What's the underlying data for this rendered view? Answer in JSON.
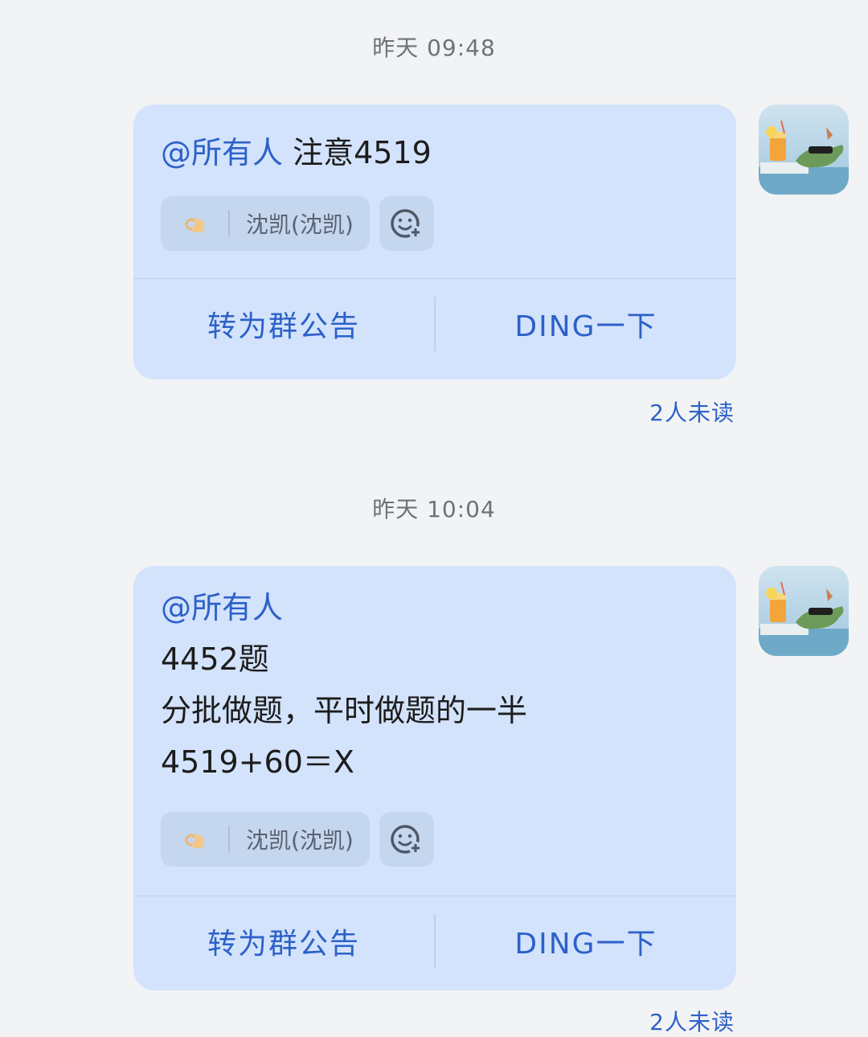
{
  "messages": [
    {
      "timestamp": "昨天 09:48",
      "mention": "@所有人",
      "text_lines": [
        "注意4519"
      ],
      "reaction": {
        "emoji": "ok-hand-icon",
        "users": "沈凯(沈凯)"
      },
      "actions": [
        "转为群公告",
        "DING一下"
      ],
      "read_status": "2人未读"
    },
    {
      "timestamp": "昨天 10:04",
      "mention": "@所有人",
      "text_lines": [
        "4452题",
        "分批做题，平时做题的一半",
        "4519+60＝X"
      ],
      "reaction": {
        "emoji": "ok-hand-icon",
        "users": "沈凯(沈凯)"
      },
      "actions": [
        "转为群公告",
        "DING一下"
      ],
      "read_status": "2人未读"
    }
  ],
  "colors": {
    "bubble": "#d3e3fc",
    "accent": "#2d61c8",
    "background": "#f2f3f5"
  }
}
